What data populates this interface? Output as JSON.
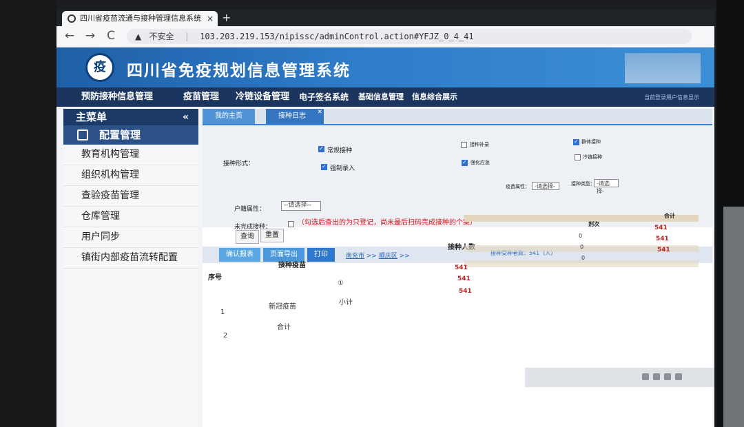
{
  "browser": {
    "tab_title": "四川省疫苗流通与接种管理信息系统",
    "new_tab": "+",
    "tab_close": "×",
    "insecure_label": "不安全",
    "url": "103.203.219.153/nipissc/adminControl.action#YFJZ_0_4_41",
    "nav": {
      "back": "←",
      "forward": "→",
      "reload": "C"
    }
  },
  "app": {
    "title": "四川省免疫规划信息管理系统",
    "logo": "疫",
    "header_small": "当前登录用户信息显示"
  },
  "topnav": [
    "预防接种信息管理",
    "疫苗管理",
    "冷链设备管理",
    "电子签名系统",
    "基础信息管理",
    "信息综合展示"
  ],
  "sidebar": {
    "title": "主菜单",
    "collapse": "«",
    "section": "配置管理",
    "items": [
      "教育机构管理",
      "组织机构管理",
      "查验疫苗管理",
      "仓库管理",
      "用户同步",
      "镇街内部疫苗流转配置"
    ]
  },
  "tabs": [
    "我的主页",
    "接种日志"
  ],
  "filter": {
    "jz_label": "接种形式：",
    "options": [
      {
        "label": "常规接种",
        "checked": true
      },
      {
        "label": "接种补录",
        "checked": false
      },
      {
        "label": "群体接种",
        "checked": true
      },
      {
        "label": "强制录入",
        "checked": true
      },
      {
        "label": "强化应急",
        "checked": true
      },
      {
        "label": "冷链接种",
        "checked": false
      }
    ],
    "vaccine_attr_label": "疫苗属性：",
    "vaccine_attr_value": "-请选择-",
    "jz_type_label": "接种类型：",
    "jz_type_value": "-请选择-",
    "hj_label": "户籍属性：",
    "hj_value": "--请选择--",
    "wwc_label": "未完成接种：",
    "note": "（勾选后查出的为只登记，尚未最后扫码完成接种的个案）",
    "query": "查询",
    "reset": "重置"
  },
  "actions": {
    "confirm": "确认报表",
    "export": "页面导出",
    "print": "打印",
    "crumb_city": "南充市",
    "crumb_district": "顺庆区",
    "crumb_sep": ">>"
  },
  "grid": {
    "col_count": "接种人数",
    "col_seq": "序号",
    "col_vaccine": "接种疫苗",
    "col_right1": "剂次",
    "col_right2": "合计",
    "summary": "接种受种者数：541（人）",
    "rows": [
      {
        "seq": "1",
        "vaccine": "新冠疫苗",
        "dose": "①",
        "sub": "小计"
      },
      {
        "seq": "2",
        "vaccine": "合计",
        "dose": "",
        "sub": ""
      }
    ],
    "counts": [
      "541",
      "541",
      "541"
    ],
    "right_vals": [
      "541",
      "541",
      "541"
    ],
    "right_zeros": [
      "0",
      "0",
      "0"
    ]
  }
}
